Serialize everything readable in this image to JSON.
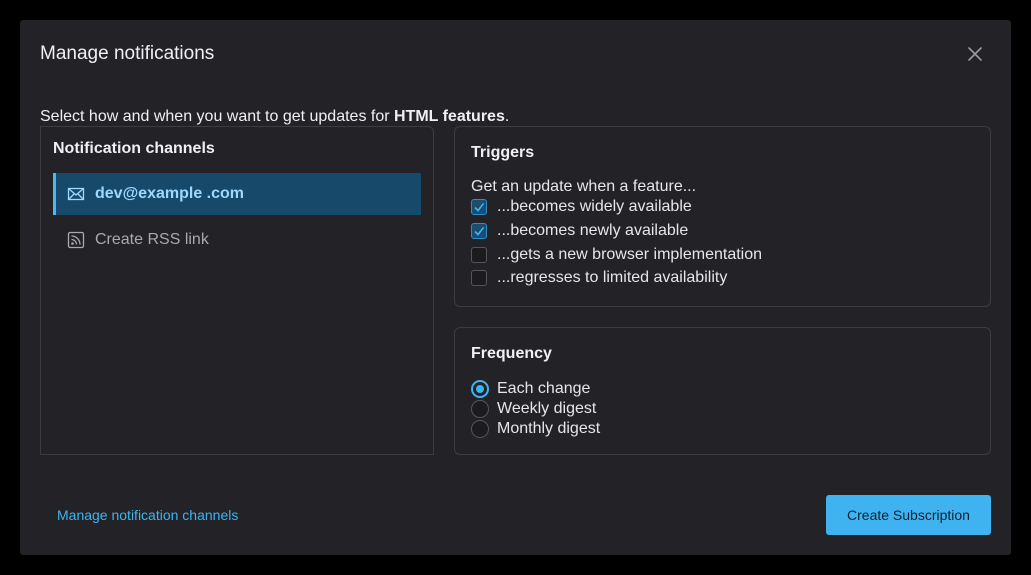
{
  "dialog": {
    "title": "Manage notifications",
    "intro_prefix": "Select how and when you want to get updates for ",
    "intro_feature": "HTML features",
    "intro_suffix": "."
  },
  "channels": {
    "title": "Notification channels",
    "items": [
      {
        "label": "dev@example .com",
        "icon": "mail-icon",
        "active": true
      },
      {
        "label": "Create RSS link",
        "icon": "rss-icon",
        "active": false
      }
    ]
  },
  "triggers": {
    "title": "Triggers",
    "description": "Get an update when a feature...",
    "options": [
      {
        "label": "...becomes widely available",
        "checked": true
      },
      {
        "label": "...becomes newly available",
        "checked": true
      },
      {
        "label": "...gets a new browser implementation",
        "checked": false
      },
      {
        "label": "...regresses to limited availability",
        "checked": false
      }
    ]
  },
  "frequency": {
    "title": "Frequency",
    "options": [
      {
        "label": "Each change",
        "selected": true
      },
      {
        "label": "Weekly digest",
        "selected": false
      },
      {
        "label": "Monthly digest",
        "selected": false
      }
    ]
  },
  "footer": {
    "manage_link": "Manage notification channels",
    "create_button": "Create Subscription"
  },
  "colors": {
    "accent": "#3fb3f0",
    "active_channel_bg": "#16496a",
    "dialog_bg": "#232327"
  }
}
